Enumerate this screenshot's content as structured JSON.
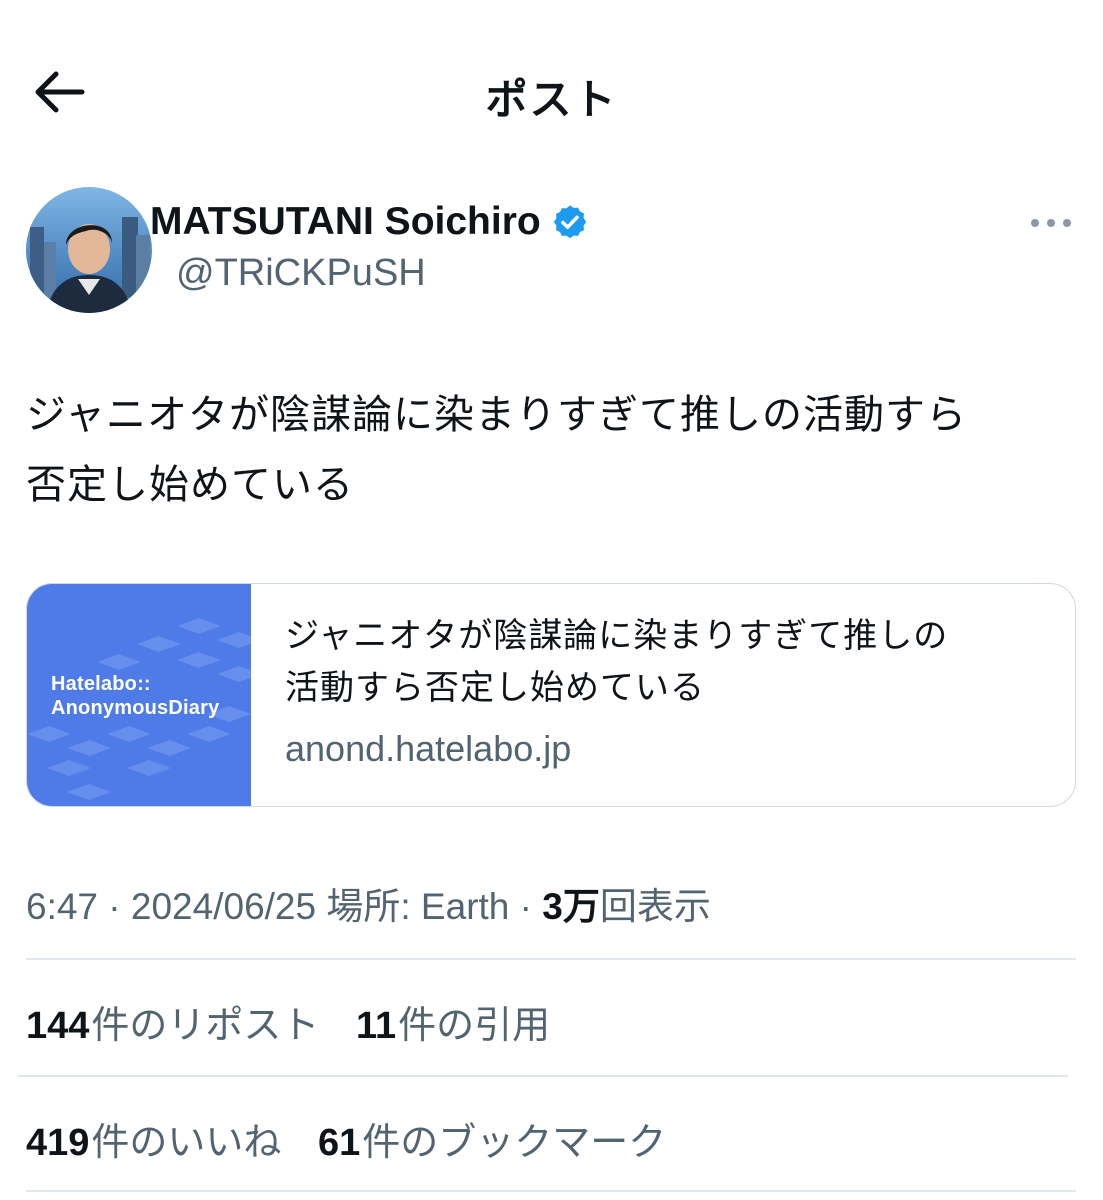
{
  "header": {
    "title": "ポスト",
    "back_icon": "arrow-left-icon"
  },
  "author": {
    "display_name": "MATSUTANI Soichiro",
    "handle": "@TRiCKPuSH",
    "verified": true,
    "verified_color": "#1d9bf0",
    "more_icon": "more-horizontal-icon"
  },
  "post": {
    "text_line1": "ジャニオタが陰謀論に染まりすぎて推しの活動すら",
    "text_line2": "否定し始めている"
  },
  "link_card": {
    "brand_line1": "Hatelabo::",
    "brand_line2": "AnonymousDiary",
    "title_line1": "ジャニオタが陰謀論に染まりすぎて推しの",
    "title_line2": "活動すら否定し始めている",
    "domain": "anond.hatelabo.jp",
    "image_color": "#4f7be8"
  },
  "meta": {
    "time": "6:47",
    "sep1": "·",
    "date": "2024/06/25",
    "location": "場所: Earth",
    "sep2": "·",
    "views_count": "3万",
    "views_label": "回表示"
  },
  "stats": {
    "reposts_count": "144",
    "reposts_label": "件のリポスト",
    "quotes_count": "11",
    "quotes_label": "件の引用",
    "likes_count": "419",
    "likes_label": "件のいいね",
    "bookmarks_count": "61",
    "bookmarks_label": "件のブックマーク"
  },
  "colors": {
    "text_primary": "#0f1419",
    "text_secondary": "#536471",
    "border": "#cfd9de"
  }
}
